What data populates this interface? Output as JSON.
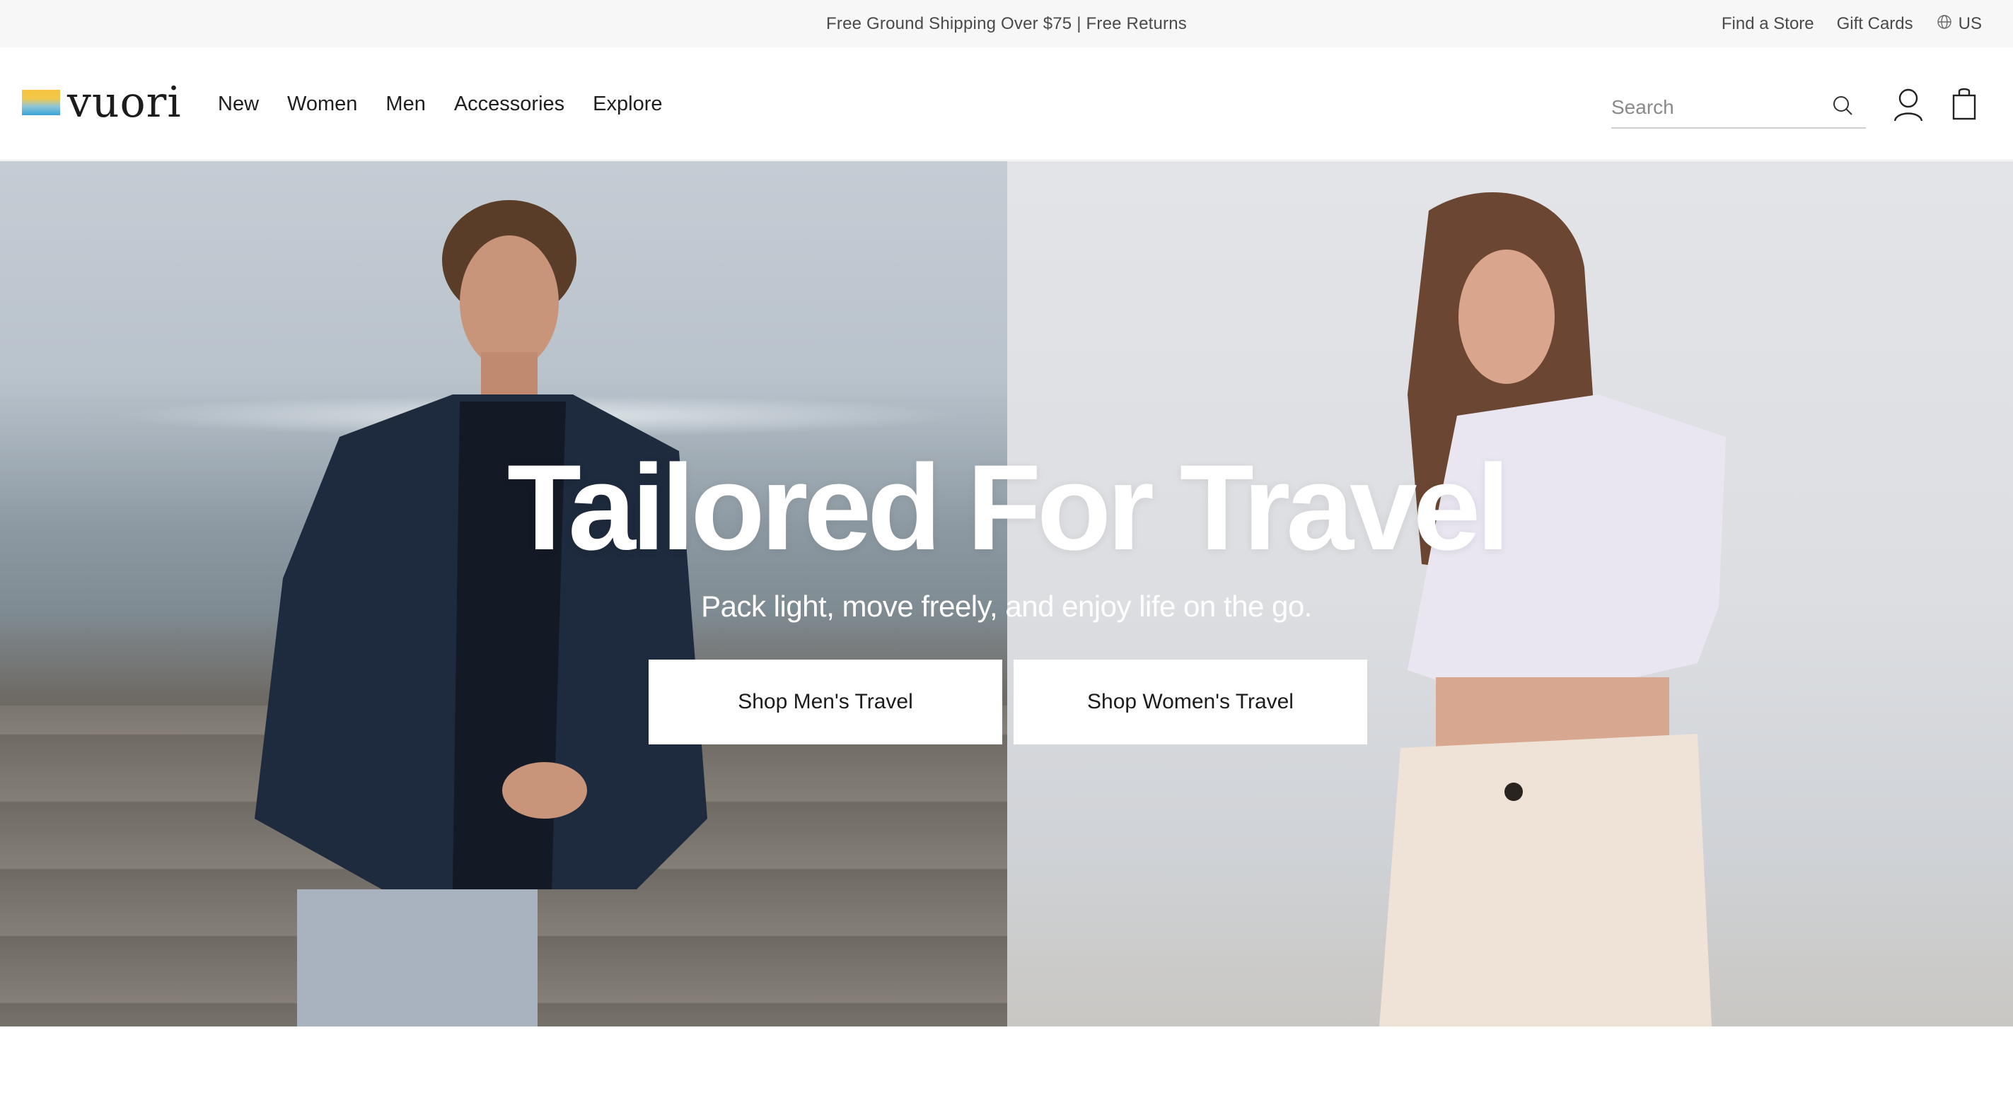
{
  "announcement": {
    "text": "Free Ground Shipping Over $75 | Free Returns",
    "links": {
      "find_store": "Find a Store",
      "gift_cards": "Gift Cards",
      "region": "US"
    }
  },
  "header": {
    "logo_text": "vuori",
    "nav": [
      "New",
      "Women",
      "Men",
      "Accessories",
      "Explore"
    ],
    "search_placeholder": "Search",
    "icons": {
      "search": "search-icon",
      "account": "user-icon",
      "cart": "shopping-bag-icon",
      "region": "globe-icon"
    }
  },
  "hero": {
    "title": "Tailored For Travel",
    "subtitle": "Pack light, move freely, and enjoy life on the go.",
    "buttons": {
      "mens": "Shop Men's Travel",
      "womens": "Shop Women's Travel"
    }
  },
  "colors": {
    "announcement_bg": "#f7f7f7",
    "text": "#1a1a1a",
    "button_bg": "#ffffff"
  }
}
